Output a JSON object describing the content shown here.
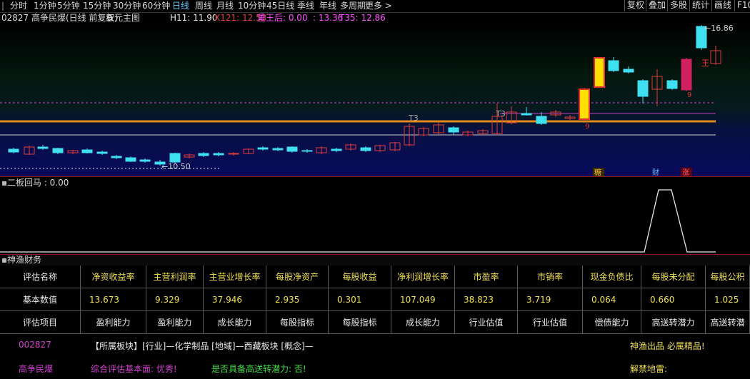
{
  "toolbar": {
    "periods": [
      "分时",
      "1分钟",
      "5分钟",
      "15分钟",
      "30分钟",
      "60分钟",
      "日线",
      "周线",
      "月线",
      "10分钟",
      "45日线",
      "季线",
      "年线",
      "多周期"
    ],
    "active_period": "日线",
    "more_label": "更多",
    "more_arrow": ">",
    "left_icon": "|",
    "buttons": [
      "复权",
      "叠加",
      "多股",
      "统计",
      "画线",
      "F10"
    ]
  },
  "info": {
    "title": "02827 高争民爆(日线 前复权)",
    "chart_selector": "三元主图",
    "h11": "H11: 11.90",
    "x121": "X121: 12.53",
    "mid_label": "重王后: 0.00",
    "mid_value": ": 13.36",
    "t35": "T35: 12.86"
  },
  "main_chart": {
    "high_label": "16.86",
    "low_label": "10.50",
    "t3_labels": [
      "T3",
      "T3"
    ],
    "candle_tags": [
      "9",
      "9",
      "王"
    ],
    "bottom_tags": [
      "糖",
      "财",
      "涨"
    ]
  },
  "sub_chart": {
    "title": "二板回马 : 0.00"
  },
  "finance": {
    "title": "神渔财务",
    "row_headers": [
      "评估名称",
      "基本数值",
      "评估项目"
    ],
    "columns": [
      "净资收益率",
      "主营利润率",
      "主营业增长率",
      "每股净资产",
      "每股收益",
      "净利润增长率",
      "市盈率",
      "市销率",
      "现金负债比",
      "每股未分配",
      "每股公积"
    ],
    "values": [
      "13.673",
      "9.329",
      "37.946",
      "2.935",
      "0.301",
      "107.049",
      "38.823",
      "3.719",
      "0.064",
      "0.660",
      "1.025"
    ],
    "categories": [
      "盈利能力",
      "盈利能力",
      "成长能力",
      "每股指标",
      "每股指标",
      "成长能力",
      "行业估值",
      "行业估值",
      "偿债能力",
      "高送转潜力",
      "高送转潜"
    ]
  },
  "footer": {
    "code": "002827",
    "sector_line": "【所属板块】[行业]—化学制品 [地域]—西藏板块 [概念]—",
    "slogan": "神渔出品 必属精品!",
    "name": "高争民爆",
    "rating": "综合评估基本面: 优秀!",
    "potential": "是否具备高送转潜力: 否!",
    "mine": "解禁地雷:"
  }
}
